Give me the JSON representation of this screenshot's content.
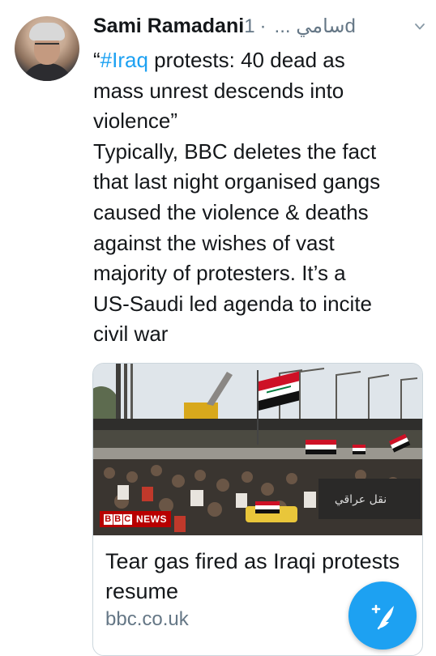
{
  "tweet": {
    "author_name": "Sami Ramadani",
    "author_handle": "سامي ...",
    "separator": "·",
    "time": "1d",
    "hashtag": "#Iraq",
    "line1_open_quote": "“",
    "line1_rest": " protests: 40 dead as",
    "lines": [
      "mass unrest descends into",
      "violence”",
      "Typically, BBC deletes the fact",
      "that last night organised gangs",
      "caused the violence & deaths",
      "against the wishes of vast",
      "majority of protesters. It’s a",
      "US-Saudi led agenda to incite",
      "civil war"
    ]
  },
  "card": {
    "badge_brand": [
      "B",
      "B",
      "C"
    ],
    "badge_label": "NEWS",
    "sign_text": "نقل عراقي",
    "title": "Tear gas fired as Iraqi protests resume",
    "domain": "bbc.co.uk"
  },
  "icons": {
    "menu": "chevron-down-icon",
    "compose": "compose-tweet-icon"
  },
  "colors": {
    "accent": "#1da1f2",
    "muted": "#657786",
    "bbc_red": "#b80000"
  }
}
